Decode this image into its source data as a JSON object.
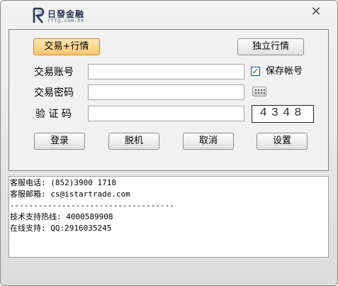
{
  "title": {
    "brand": "日發金融",
    "domain": "rffg.com.hk",
    "close_glyph": "✕"
  },
  "top_buttons": {
    "trade_quote": "交易+行情",
    "standalone_quote": "独立行情"
  },
  "form": {
    "account_label": "交易账号",
    "account_value": "",
    "save_account_label": "保存帐号",
    "save_account_checked": true,
    "password_label": "交易密码",
    "password_value": "",
    "captcha_label": "验 证 码",
    "captcha_value": "",
    "captcha_image_text": "4348"
  },
  "actions": {
    "login": "登录",
    "offline": "脱机",
    "cancel": "取消",
    "settings": "设置"
  },
  "info_lines": [
    "客服电话: (852)3900 1718",
    "客服邮箱: cs@istartrade.com",
    "-----------------------------------",
    "技术支持热线: 4000589908",
    "在线支持: QQ:2916035245"
  ],
  "colors": {
    "active_button": "#ffc670",
    "brand_text": "#2a3650"
  },
  "icons": {
    "dropdown": "chevron-down-icon",
    "keyboard": "soft-keyboard-icon",
    "checkbox": "checkmark-icon",
    "close": "close-icon"
  }
}
